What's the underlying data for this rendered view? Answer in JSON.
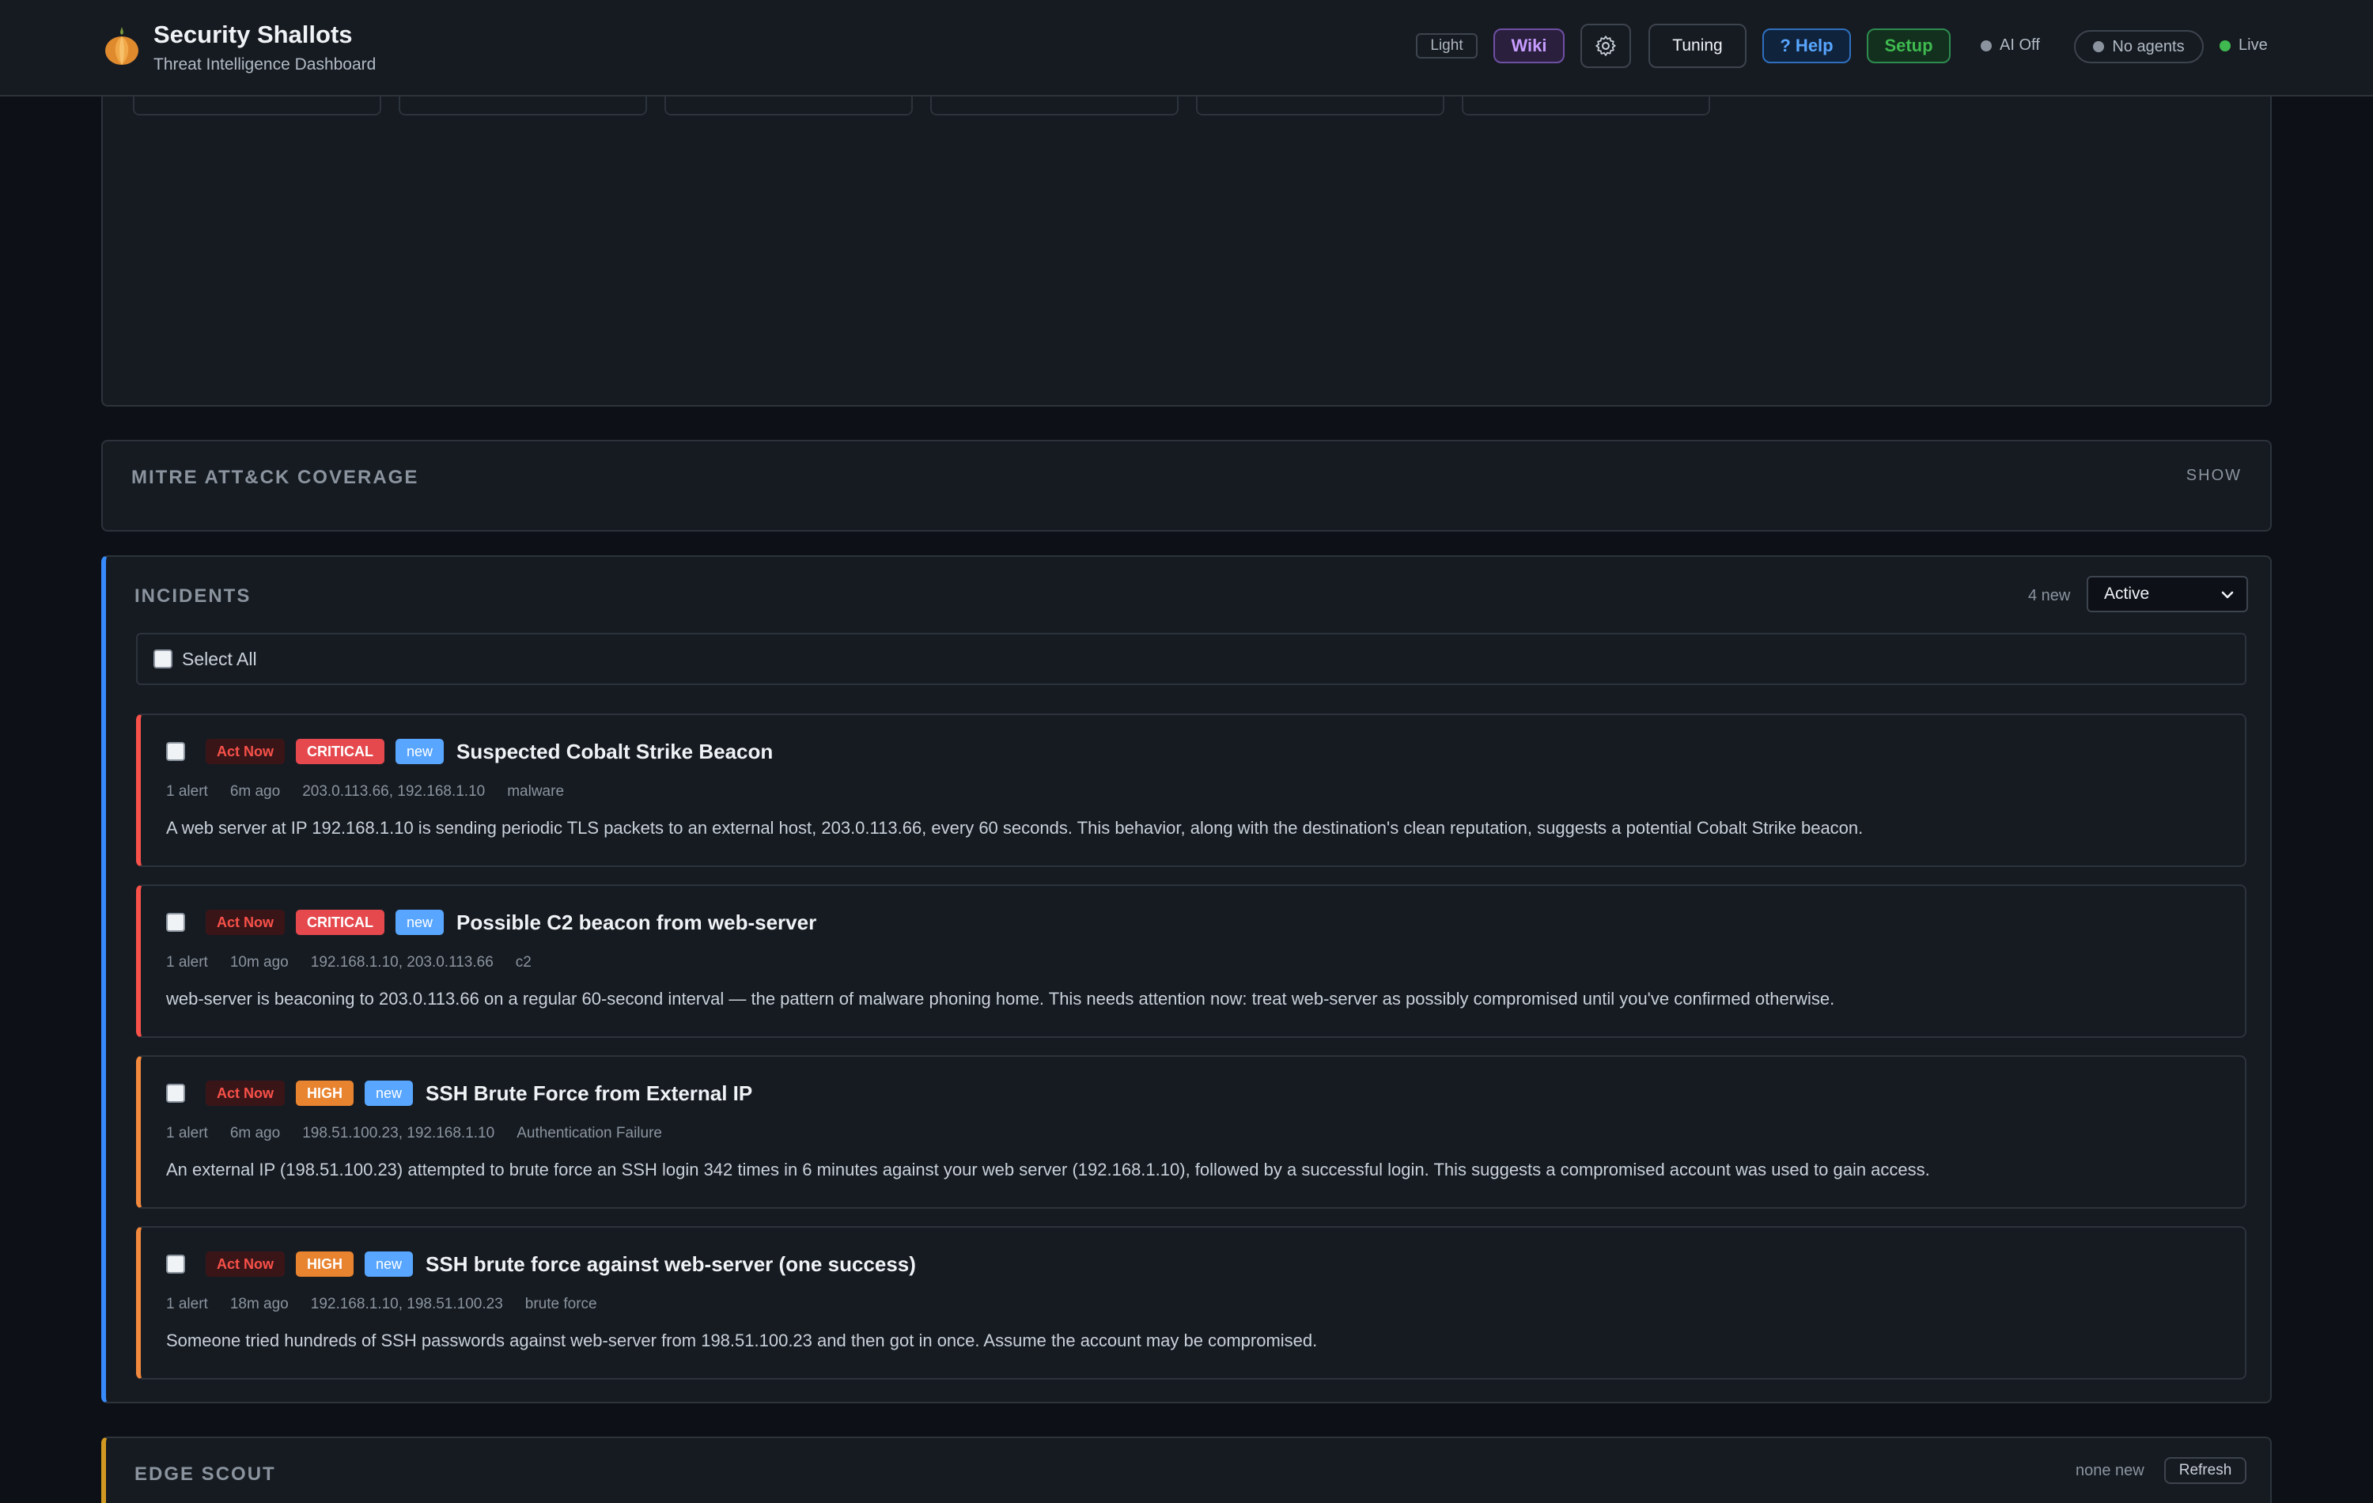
{
  "header": {
    "app_title": "Security Shallots",
    "app_subtitle": "Threat Intelligence Dashboard",
    "theme_toggle_label": "Light",
    "wiki_label": "Wiki",
    "tuning_label": "Tuning",
    "help_label": "? Help",
    "setup_label": "Setup",
    "ai_status": "AI Off",
    "agents_status": "No agents",
    "live_status": "Live"
  },
  "mitre": {
    "title": "MITRE ATT&CK COVERAGE",
    "toggle_label": "SHOW"
  },
  "incidents": {
    "title": "INCIDENTS",
    "new_count": "4 new",
    "filter_value": "Active",
    "select_all_label": "Select All",
    "items": [
      {
        "priority": "Act Now",
        "severity": "CRITICAL",
        "state": "new",
        "title": "Suspected Cobalt Strike Beacon",
        "alerts": "1 alert",
        "age": "6m ago",
        "ips": "203.0.113.66, 192.168.1.10",
        "category": "malware",
        "description": "A web server at IP 192.168.1.10 is sending periodic TLS packets to an external host, 203.0.113.66, every 60 seconds. This behavior, along with the destination's clean reputation, suggests a potential Cobalt Strike beacon."
      },
      {
        "priority": "Act Now",
        "severity": "CRITICAL",
        "state": "new",
        "title": "Possible C2 beacon from web-server",
        "alerts": "1 alert",
        "age": "10m ago",
        "ips": "192.168.1.10, 203.0.113.66",
        "category": "c2",
        "description": "web-server is beaconing to 203.0.113.66 on a regular 60-second interval — the pattern of malware phoning home. This needs attention now: treat web-server as possibly compromised until you've confirmed otherwise."
      },
      {
        "priority": "Act Now",
        "severity": "HIGH",
        "state": "new",
        "title": "SSH Brute Force from External IP",
        "alerts": "1 alert",
        "age": "6m ago",
        "ips": "198.51.100.23, 192.168.1.10",
        "category": "Authentication Failure",
        "description": "An external IP (198.51.100.23) attempted to brute force an SSH login 342 times in 6 minutes against your web server (192.168.1.10), followed by a successful login. This suggests a compromised account was used to gain access."
      },
      {
        "priority": "Act Now",
        "severity": "HIGH",
        "state": "new",
        "title": "SSH brute force against web-server (one success)",
        "alerts": "1 alert",
        "age": "18m ago",
        "ips": "192.168.1.10, 198.51.100.23",
        "category": "brute force",
        "description": "Someone tried hundreds of SSH passwords against web-server from 198.51.100.23 and then got in once. Assume the account may be compromised."
      }
    ]
  },
  "edge_scout": {
    "title": "EDGE SCOUT",
    "new_count": "none new",
    "refresh_label": "Refresh"
  },
  "colors": {
    "background": "#0d1117",
    "panel": "#161b22",
    "critical": "#e5484d",
    "high": "#e8832f",
    "new": "#58a6ff",
    "incidents_accent": "#388bfd",
    "edge_scout_accent": "#d29922"
  }
}
